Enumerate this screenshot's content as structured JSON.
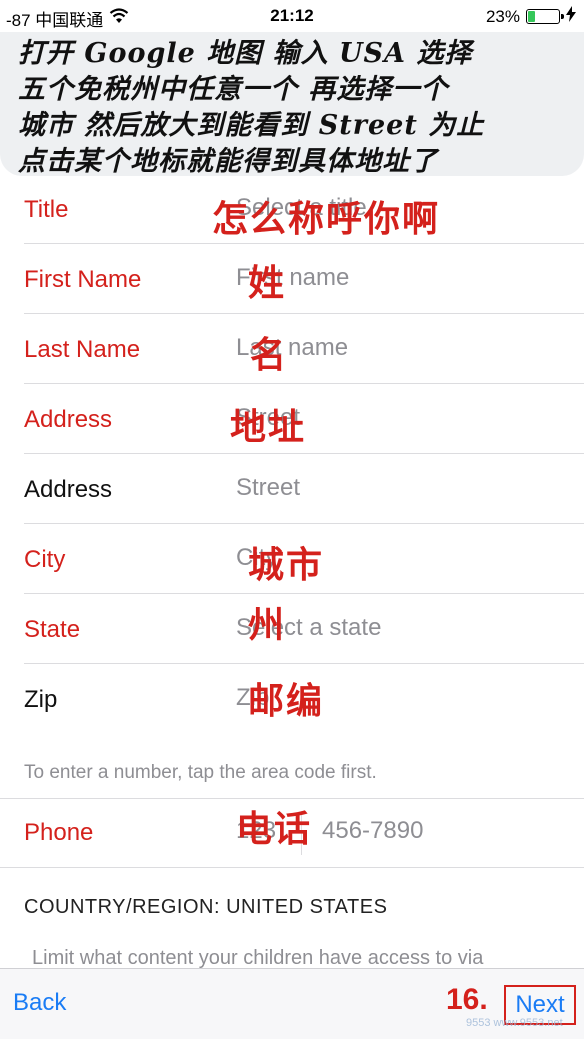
{
  "status_bar": {
    "carrier": "-87 中国联通",
    "time": "21:12",
    "battery_pct": "23%",
    "battery_level": 0.23
  },
  "instruction": {
    "lines": [
      "打开 Google 地图 输入 USA 选择",
      "五个免税州中任意一个 再选择一个",
      "城市 然后放大到能看到 Street 为止",
      "点击某个地标就能得到具体地址了"
    ]
  },
  "form": {
    "rows": [
      {
        "label": "Title",
        "value": "Select a title",
        "annotation": "怎么称呼你啊"
      },
      {
        "label": "First Name",
        "value": "First name",
        "annotation": "姓"
      },
      {
        "label": "Last Name",
        "value": "Last name",
        "annotation": "名"
      },
      {
        "label": "Address",
        "value": "Street",
        "annotation": "地址"
      },
      {
        "label": "Address",
        "value": "Street"
      },
      {
        "label": "City",
        "value": "City",
        "annotation": "城市"
      },
      {
        "label": "State",
        "value": "Select a state",
        "annotation": "州"
      },
      {
        "label": "Zip",
        "value": "Zip",
        "annotation": "邮编"
      }
    ],
    "hint": "To enter a number, tap the area code first.",
    "phone": {
      "label": "Phone",
      "area_placeholder": "123",
      "number_placeholder": "456-7890",
      "annotation": "电话"
    },
    "country": "COUNTRY/REGION: UNITED STATES",
    "limit_text": "Limit what content your children have access to via"
  },
  "toolbar": {
    "back_label": "Back",
    "step_label": "16.",
    "next_label": "Next",
    "watermark": "9553 www.9553.net"
  },
  "colors": {
    "accent_blue": "#1a7cf5",
    "annotation_red": "#d4211c",
    "placeholder_gray": "#8e8e93"
  }
}
